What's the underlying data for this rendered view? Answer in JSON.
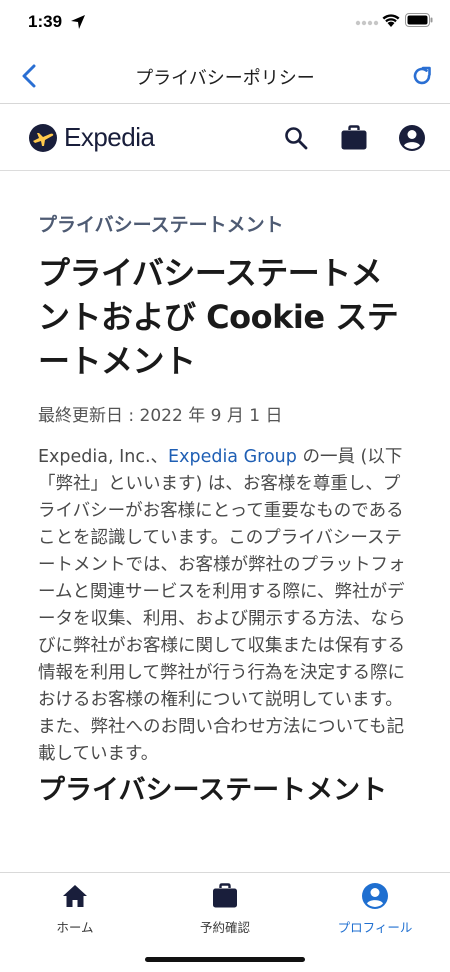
{
  "status_bar": {
    "time": "1:39"
  },
  "nav": {
    "title": "プライバシーポリシー",
    "icons": [
      "back-icon",
      "refresh-icon"
    ]
  },
  "header": {
    "logo_text": "Expedia",
    "icons": [
      "search-icon",
      "briefcase-icon",
      "account-icon"
    ]
  },
  "content": {
    "eyebrow": "プライバシーステートメント",
    "title": "プライバシーステートメントおよび Cookie ステートメント",
    "last_updated": "最終更新日 : 2022 年 9 月 1 日",
    "body_before_link": "Expedia, Inc.、",
    "body_link": "Expedia Group",
    "body_after_link": " の一員 (以下「弊社」といいます) は、お客様を尊重し、プライバシーがお客様にとって重要なものであることを認識しています。このプライバシーステートメントでは、お客様が弊社のプラットフォームと関連サービスを利用する際に、弊社がデータを収集、利用、および開示する方法、ならびに弊社がお客様に関して収集または保有する情報を利用して弊社が行う行為を決定する際におけるお客様の権利について説明しています。また、弊社へのお問い合わせ方法についても記載しています。",
    "subheading": "プライバシーステートメント"
  },
  "tabs": [
    {
      "label": "ホーム",
      "icon": "home-icon",
      "active": false
    },
    {
      "label": "予約確認",
      "icon": "briefcase-icon",
      "active": false
    },
    {
      "label": "プロフィール",
      "icon": "account-icon",
      "active": true
    }
  ],
  "colors": {
    "accent": "#1f6fd0",
    "brand_navy": "#191e3b",
    "link": "#1f5fb4"
  }
}
